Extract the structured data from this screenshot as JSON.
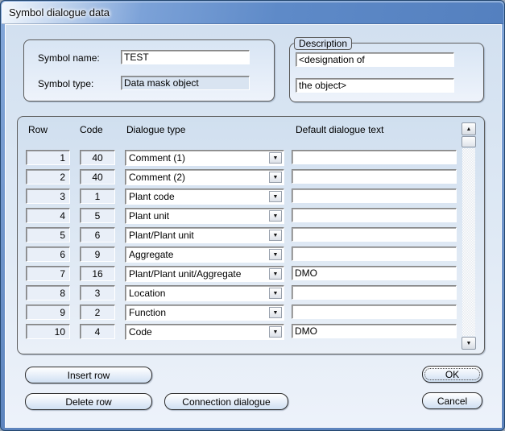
{
  "window": {
    "title": "Symbol dialogue data"
  },
  "symbol_section": {
    "name_label": "Symbol name:",
    "name_value": "TEST",
    "type_label": "Symbol type:",
    "type_value": "Data mask object"
  },
  "description_section": {
    "label": "Description",
    "line1": "<designation of",
    "line2": "the object>"
  },
  "table": {
    "headers": {
      "row": "Row",
      "code": "Code",
      "type": "Dialogue type",
      "text": "Default dialogue text"
    },
    "rows": [
      {
        "row": "1",
        "code": "40",
        "type": "Comment (1)",
        "text": ""
      },
      {
        "row": "2",
        "code": "40",
        "type": "Comment (2)",
        "text": ""
      },
      {
        "row": "3",
        "code": "1",
        "type": "Plant code",
        "text": ""
      },
      {
        "row": "4",
        "code": "5",
        "type": "Plant unit",
        "text": ""
      },
      {
        "row": "5",
        "code": "6",
        "type": "Plant/Plant unit",
        "text": ""
      },
      {
        "row": "6",
        "code": "9",
        "type": "Aggregate",
        "text": ""
      },
      {
        "row": "7",
        "code": "16",
        "type": "Plant/Plant unit/Aggregate",
        "text": "DMO"
      },
      {
        "row": "8",
        "code": "3",
        "type": "Location",
        "text": ""
      },
      {
        "row": "9",
        "code": "2",
        "type": "Function",
        "text": ""
      },
      {
        "row": "10",
        "code": "4",
        "type": "Code",
        "text": "DMO"
      }
    ]
  },
  "buttons": {
    "insert_row": "Insert row",
    "delete_row": "Delete row",
    "connection_dialogue": "Connection dialogue",
    "ok": "OK",
    "cancel": "Cancel"
  },
  "icons": {
    "scroll_up_glyph": "▲",
    "scroll_down_glyph": "▼",
    "dropdown_glyph": "▼"
  },
  "colors": {
    "title_bar_blue": "#5e8ac8",
    "frame_band": "#7aa0d6",
    "window_border": "#24476f",
    "client_top": "#d2e0f0",
    "client_bottom": "#edf2fa"
  }
}
